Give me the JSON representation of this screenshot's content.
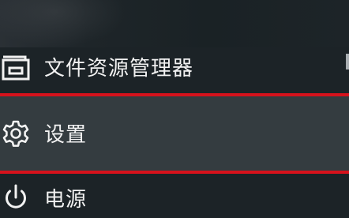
{
  "menu": {
    "items": [
      {
        "label": "文件资源管理器",
        "icon": "folder-icon"
      },
      {
        "label": "设置",
        "icon": "gear-icon"
      },
      {
        "label": "电源",
        "icon": "power-icon"
      }
    ],
    "highlight_color": "#d6121c",
    "hover_bg": "#343c40",
    "text_color": "#f2f2f2"
  }
}
